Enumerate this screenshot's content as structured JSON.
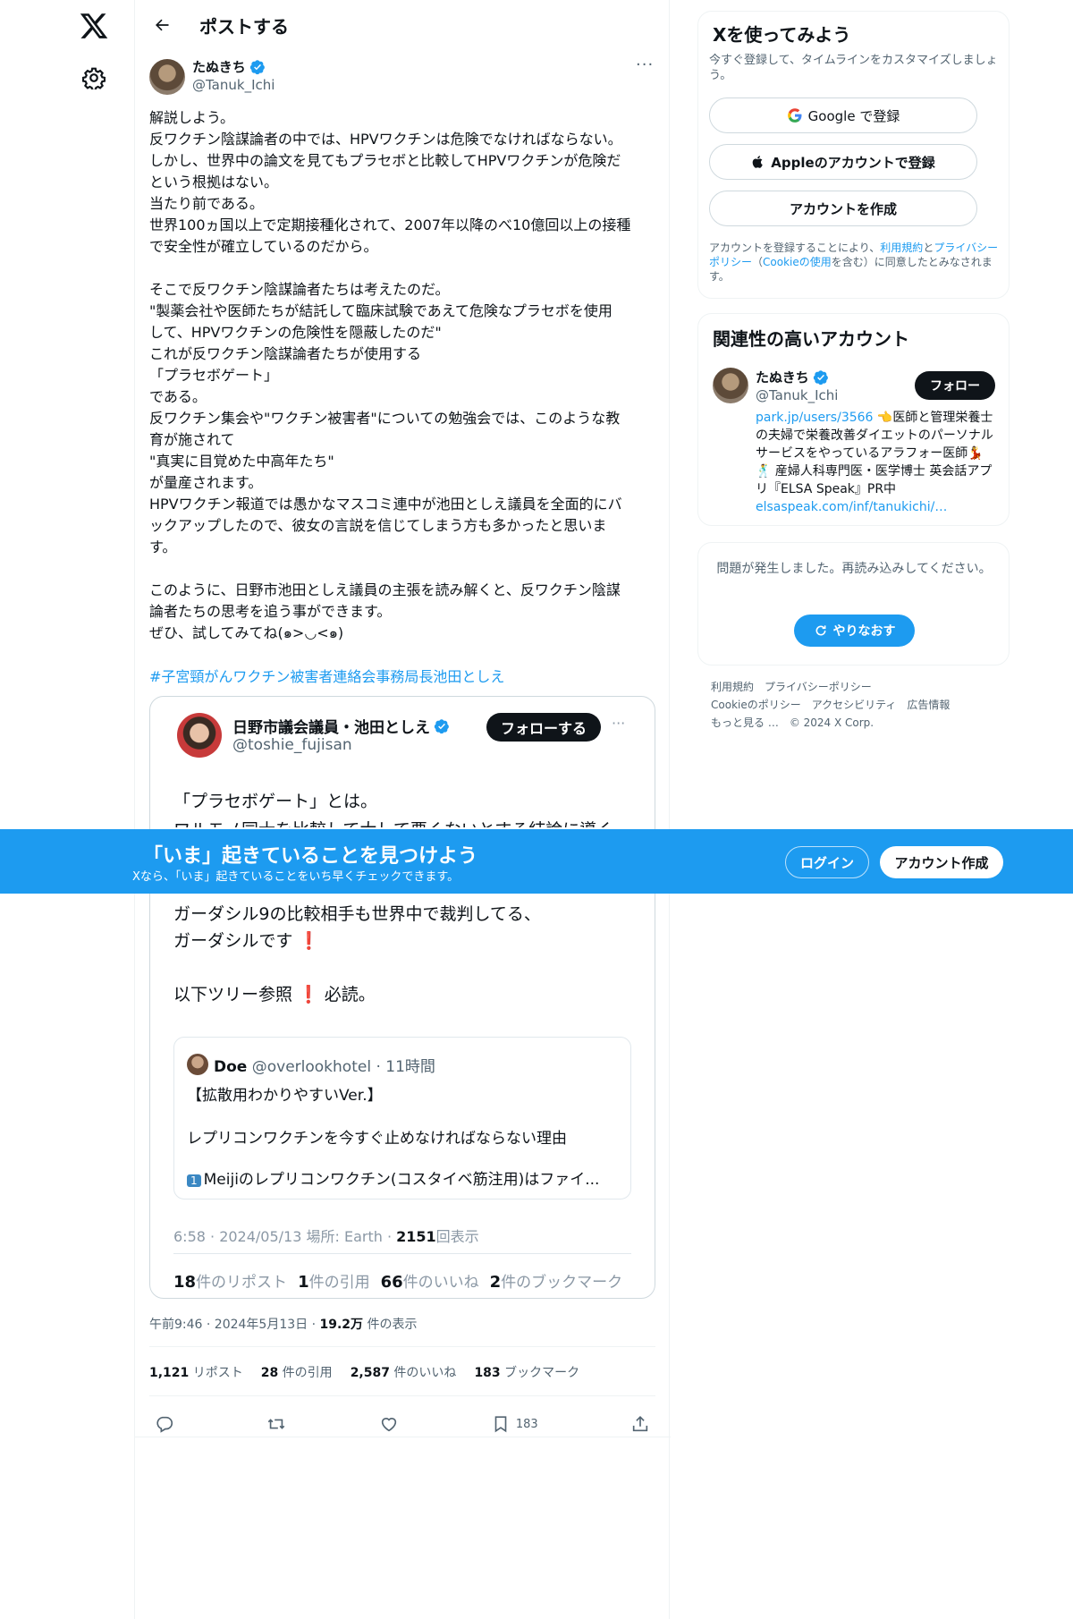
{
  "header": {
    "title": "ポストする"
  },
  "post": {
    "author_name": "たぬきち",
    "author_handle": "@Tanuk_Ichi",
    "more": "···",
    "text_lines": [
      "解説しよう。",
      "反ワクチン陰謀論者の中では、HPVワクチンは危険でなければならない。",
      "しかし、世界中の論文を見てもプラセボと比較してHPVワクチンが危険だ",
      "という根拠はない。",
      "当たり前である。",
      "世界100ヵ国以上で定期接種化されて、2007年以降のべ10億回以上の接種",
      "で安全性が確立しているのだから。",
      "",
      "そこで反ワクチン陰謀論者たちは考えたのだ。",
      "\"製薬会社や医師たちが結託して臨床試験であえて危険なプラセボを使用",
      "して、HPVワクチンの危険性を隠蔽したのだ\"",
      "これが反ワクチン陰謀論者たちが使用する",
      "「プラセボゲート」",
      "である。",
      "反ワクチン集会や\"ワクチン被害者\"についての勉強会では、このような教",
      "育が施されて",
      "\"真実に目覚めた中高年たち\"",
      "が量産されます。",
      "HPVワクチン報道では愚かなマスコミ連中が池田としえ議員を全面的にバ",
      "ックアップしたので、彼女の言説を信じてしまう方も多かったと思いま",
      "す。",
      "",
      "このように、日野市池田としえ議員の主張を読み解くと、反ワクチン陰謀",
      "論者たちの思考を追う事ができます。",
      "ぜひ、試してみてね(๑>◡<๑)"
    ],
    "hashtag": "#子宮頸がんワクチン被害者連絡会事務局長池田としえ",
    "quote": {
      "name": "日野市議会議員・池田としえ",
      "handle": "@toshie_fujisan",
      "follow_label": "フォローする",
      "more": "···",
      "line1": "「プラセボゲート」とは。",
      "line2": "ワルモノ同士を比較して大して悪くないとする結論に導く",
      "lines_after": [
        "ガーダシル9の比較相手も世界中で裁判してる、",
        "ガーダシルです",
        "",
        "以下ツリー参照",
        "必読。"
      ],
      "exclaim": "❗",
      "inner": {
        "name": "Doe",
        "handle": "@overlookhotel",
        "time": "· 11時間",
        "line1": "【拡散用わかりやすいVer.】",
        "line2": "レプリコンワクチンを今すぐ止めなければならない理由",
        "keycap": "1",
        "line3": "Meijiのレプリコンワクチン(コスタイベ筋注用)はファイ..."
      },
      "meta_time": "6:58 · 2024/05/13 場所: Earth · ",
      "meta_views": "2151",
      "meta_views_label": "回表示",
      "stats": [
        {
          "value": "18",
          "label": "件のリポスト"
        },
        {
          "value": "1",
          "label": "件の引用"
        },
        {
          "value": "66",
          "label": "件のいいね"
        },
        {
          "value": "2",
          "label": "件のブックマーク"
        }
      ]
    },
    "meta_time": "午前9:46 · 2024年5月13日 · ",
    "meta_views": "19.2万",
    "meta_views_label": " 件の表示",
    "stats": [
      {
        "value": "1,121",
        "label": " リポスト"
      },
      {
        "value": "28",
        "label": " 件の引用"
      },
      {
        "value": "2,587",
        "label": " 件のいいね"
      },
      {
        "value": "183",
        "label": " ブックマーク"
      }
    ],
    "bookmark_count": "183"
  },
  "sidebar": {
    "signup": {
      "title": "Xを使ってみよう",
      "subtitle": "今すぐ登録して、タイムラインをカスタマイズしましょう。",
      "google_label": "Google で登録",
      "apple_label": "Appleのアカウントで登録",
      "create_label": "アカウントを作成",
      "terms_pre": "アカウントを登録することにより、",
      "terms_link1": "利用規約",
      "terms_mid1": "と",
      "terms_link2": "プライバシーポリシー",
      "terms_mid2": "（",
      "terms_link3": "Cookieの使用",
      "terms_post": "を含む）に同意したとみなされます。"
    },
    "related": {
      "title": "関連性の高いアカウント",
      "name": "たぬきち",
      "handle": "@Tanuk_Ichi",
      "follow_label": "フォロー",
      "bio_link1": "park.jp/users/3566",
      "bio_text": " 👈医師と管理栄養士の夫婦で栄養改善ダイエットのパーソナルサービスをやっているアラフォー医師💃🕺 産婦人科専門医・医学博士 英会話アプリ『ELSA Speak』PR中",
      "bio_link2": "elsaspeak.com/inf/tanukichi/…"
    },
    "error": {
      "message": "問題が発生しました。再読み込みしてください。",
      "retry_label": "やりなおす"
    },
    "footer": [
      "利用規約",
      "プライバシーポリシー",
      "Cookieのポリシー",
      "アクセシビリティ",
      "広告情報",
      "もっと見る …",
      "© 2024 X Corp."
    ]
  },
  "banner": {
    "title": "「いま」起きていることを見つけよう",
    "subtitle": "Xなら、「いま」起きていることをいち早くチェックできます。",
    "login_label": "ログイン",
    "signup_label": "アカウント作成"
  },
  "colors": {
    "accent": "#1d9bf0",
    "text": "#0f1419",
    "muted": "#536471"
  }
}
